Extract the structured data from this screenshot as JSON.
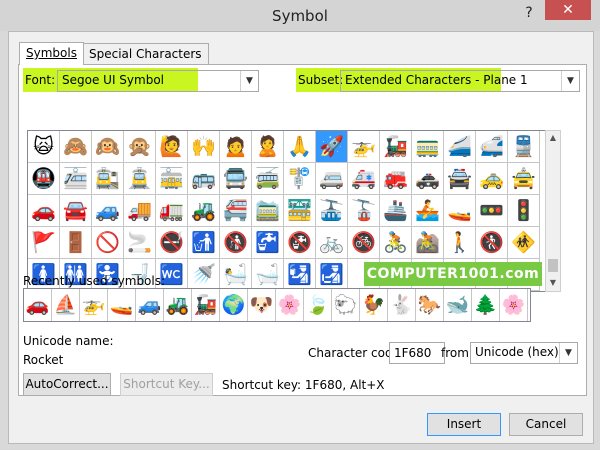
{
  "window": {
    "title": "Symbol",
    "help_glyph": "?",
    "close_glyph": "✕"
  },
  "tabs": [
    {
      "label": "Symbols",
      "active": true
    },
    {
      "label": "Special Characters",
      "active": false
    }
  ],
  "font": {
    "label": "Font:",
    "value": "Segoe UI Symbol"
  },
  "subset": {
    "label": "Subset:",
    "value": "Extended Characters - Plane 1"
  },
  "highlight_color": "#c9f520",
  "grid_rows": [
    [
      "🙀",
      "🙈",
      "🙉",
      "🙊",
      "🙋",
      "🙌",
      "🙍",
      "🙎",
      "🙏",
      "🚀",
      "🚁",
      "🚂",
      "🚃",
      "🚄",
      "🚅",
      "🚆"
    ],
    [
      "🚇",
      "🚈",
      "🚉",
      "🚊",
      "🚋",
      "🚌",
      "🚍",
      "🚎",
      "🚏",
      "🚐",
      "🚑",
      "🚒",
      "🚓",
      "🚔",
      "🚕",
      "🚖"
    ],
    [
      "🚗",
      "🚘",
      "🚙",
      "🚚",
      "🚛",
      "🚜",
      "🚝",
      "🚞",
      "🚟",
      "🚠",
      "🚡",
      "🚢",
      "🚣",
      "🚤",
      "🚥",
      "🚦"
    ],
    [
      "🚩",
      "🚪",
      "🚫",
      "🚬",
      "🚭",
      "🚮",
      "🚯",
      "🚰",
      "🚱",
      "🚲",
      "🚳",
      "🚴",
      "🚵",
      "🚶",
      "🚷",
      "🚸"
    ],
    [
      "🚺",
      "🚻",
      "🚼",
      "🚽",
      "🚾",
      "🚿",
      "🛀",
      "🛁",
      "🛂",
      "🛃",
      "",
      "",
      "",
      "",
      "",
      ""
    ]
  ],
  "selected": {
    "row": 0,
    "col": 9
  },
  "watermark": "COMPUTER1001.com",
  "recent": {
    "label": "Recently used symbols:",
    "symbols": [
      "🚗",
      "⛵",
      "🚁",
      "🚤",
      "🚙",
      "🚜",
      "🚂",
      "🌍",
      "🐶",
      "🌸",
      "🍃",
      "🐑",
      "🐓",
      "🐇",
      "🐎",
      "🐋",
      "🌲",
      "🌸"
    ]
  },
  "unicode_name": {
    "label": "Unicode name:",
    "value": "Rocket"
  },
  "char_code": {
    "label": "Character code:",
    "value": "1F680"
  },
  "from": {
    "label": "from:",
    "value": "Unicode (hex)"
  },
  "buttons": {
    "autocorrect": "AutoCorrect...",
    "shortcut_key": "Shortcut Key...",
    "insert": "Insert",
    "cancel": "Cancel"
  },
  "shortcut_text": "Shortcut key: 1F680, Alt+X"
}
